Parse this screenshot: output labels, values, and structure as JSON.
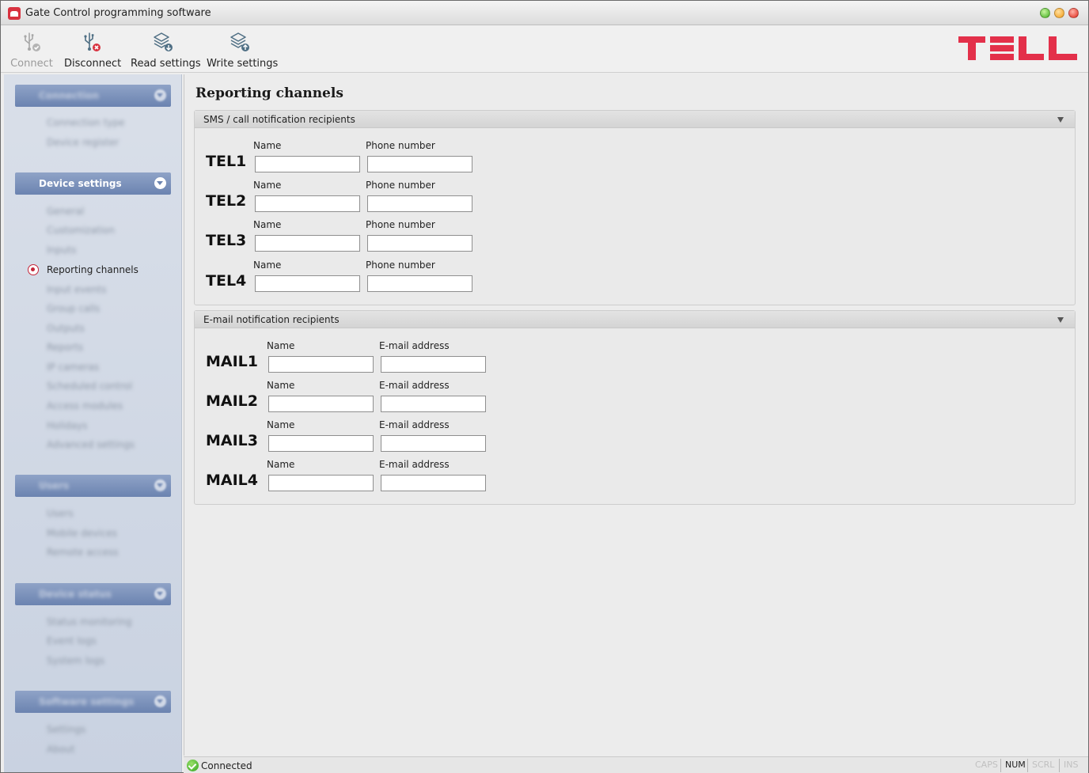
{
  "window": {
    "title": "Gate Control programming software"
  },
  "toolbar": {
    "connect_label": "Connect",
    "disconnect_label": "Disconnect",
    "read_label": "Read settings",
    "write_label": "Write settings"
  },
  "logo": {
    "text": "TELL",
    "color": "#e3304a"
  },
  "sidebar": {
    "sections": [
      {
        "label": "Connection",
        "blurred": true,
        "items": [
          "Connection type",
          "Device register"
        ]
      },
      {
        "label": "Device settings",
        "blurred": false,
        "items": [
          "General",
          "Customization",
          "Inputs",
          "Reporting channels",
          "Input events",
          "Group calls",
          "Outputs",
          "Reports",
          "IP cameras",
          "Scheduled control",
          "Access modules",
          "Holidays",
          "Advanced settings"
        ]
      },
      {
        "label": "Users",
        "blurred": true,
        "items": [
          "Users",
          "Mobile devices",
          "Remote access"
        ]
      },
      {
        "label": "Device status",
        "blurred": true,
        "items": [
          "Status monitoring",
          "Event logs",
          "System logs"
        ]
      },
      {
        "label": "Software settings",
        "blurred": true,
        "items": [
          "Settings",
          "About"
        ]
      }
    ],
    "active_item": "Reporting channels"
  },
  "content": {
    "page_title": "Reporting channels",
    "sms_group": {
      "title": "SMS / call notification recipients",
      "name_caption": "Name",
      "phone_caption": "Phone number",
      "rows": [
        {
          "label": "TEL1",
          "name": "",
          "phone": ""
        },
        {
          "label": "TEL2",
          "name": "",
          "phone": ""
        },
        {
          "label": "TEL3",
          "name": "",
          "phone": ""
        },
        {
          "label": "TEL4",
          "name": "",
          "phone": ""
        }
      ]
    },
    "mail_group": {
      "title": "E-mail notification recipients",
      "name_caption": "Name",
      "email_caption": "E-mail address",
      "rows": [
        {
          "label": "MAIL1",
          "name": "",
          "email": ""
        },
        {
          "label": "MAIL2",
          "name": "",
          "email": ""
        },
        {
          "label": "MAIL3",
          "name": "",
          "email": ""
        },
        {
          "label": "MAIL4",
          "name": "",
          "email": ""
        }
      ]
    }
  },
  "statusbar": {
    "status": "Connected",
    "indicators": [
      {
        "label": "CAPS",
        "active": false
      },
      {
        "label": "NUM",
        "active": true
      },
      {
        "label": "SCRL",
        "active": false
      },
      {
        "label": "INS",
        "active": false
      }
    ]
  }
}
